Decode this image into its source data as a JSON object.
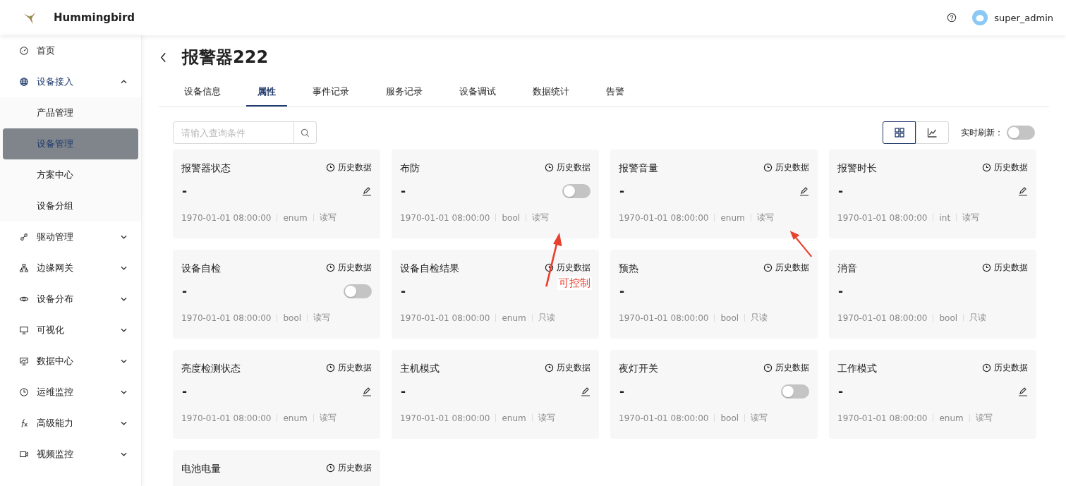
{
  "header": {
    "brand": "Hummingbird",
    "user": "super_admin"
  },
  "sidebar": {
    "items": [
      {
        "label": "首页",
        "expanded": false
      },
      {
        "label": "设备接入",
        "expanded": true,
        "children": [
          {
            "label": "产品管理",
            "selected": false
          },
          {
            "label": "设备管理",
            "selected": true
          },
          {
            "label": "方案中心",
            "selected": false
          },
          {
            "label": "设备分组",
            "selected": false
          }
        ]
      },
      {
        "label": "驱动管理",
        "expanded": false
      },
      {
        "label": "边缘网关",
        "expanded": false
      },
      {
        "label": "设备分布",
        "expanded": false
      },
      {
        "label": "可视化",
        "expanded": false
      },
      {
        "label": "数据中心",
        "expanded": false
      },
      {
        "label": "运维监控",
        "expanded": false
      },
      {
        "label": "高级能力",
        "expanded": false
      },
      {
        "label": "视频监控",
        "expanded": false
      }
    ]
  },
  "page": {
    "title": "报警器222"
  },
  "tabs": [
    {
      "label": "设备信息",
      "selected": false
    },
    {
      "label": "属性",
      "selected": true
    },
    {
      "label": "事件记录",
      "selected": false
    },
    {
      "label": "服务记录",
      "selected": false
    },
    {
      "label": "设备调试",
      "selected": false
    },
    {
      "label": "数据统计",
      "selected": false
    },
    {
      "label": "告警",
      "selected": false
    }
  ],
  "search": {
    "placeholder": "请输入查询条件"
  },
  "view_toggle": [
    {
      "kind": "grid",
      "selected": true
    },
    {
      "kind": "chart",
      "selected": false
    }
  ],
  "realtime": {
    "label": "实时刷新：",
    "on": false
  },
  "cards": [
    {
      "name": "报警器状态",
      "history": "历史数据",
      "value": "-",
      "kind": "edit",
      "time": "1970-01-01 08:00:00",
      "type": "enum",
      "access": "读写"
    },
    {
      "name": "布防",
      "history": "历史数据",
      "value": "-",
      "kind": "switch",
      "on": false,
      "time": "1970-01-01 08:00:00",
      "type": "bool",
      "access": "读写"
    },
    {
      "name": "报警音量",
      "history": "历史数据",
      "value": "-",
      "kind": "edit",
      "time": "1970-01-01 08:00:00",
      "type": "enum",
      "access": "读写"
    },
    {
      "name": "报警时长",
      "history": "历史数据",
      "value": "-",
      "kind": "edit",
      "time": "1970-01-01 08:00:00",
      "type": "int",
      "access": "读写"
    },
    {
      "name": "设备自检",
      "history": "历史数据",
      "value": "-",
      "kind": "switch",
      "on": false,
      "time": "1970-01-01 08:00:00",
      "type": "bool",
      "access": "读写"
    },
    {
      "name": "设备自检结果",
      "history": "历史数据",
      "value": "-",
      "kind": "none",
      "time": "1970-01-01 08:00:00",
      "type": "enum",
      "access": "只读"
    },
    {
      "name": "预热",
      "history": "历史数据",
      "value": "-",
      "kind": "none",
      "time": "1970-01-01 08:00:00",
      "type": "bool",
      "access": "只读"
    },
    {
      "name": "消音",
      "history": "历史数据",
      "value": "-",
      "kind": "none",
      "time": "1970-01-01 08:00:00",
      "type": "bool",
      "access": "只读"
    },
    {
      "name": "亮度检测状态",
      "history": "历史数据",
      "value": "-",
      "kind": "edit",
      "time": "1970-01-01 08:00:00",
      "type": "enum",
      "access": "读写"
    },
    {
      "name": "主机模式",
      "history": "历史数据",
      "value": "-",
      "kind": "edit",
      "time": "1970-01-01 08:00:00",
      "type": "enum",
      "access": "读写"
    },
    {
      "name": "夜灯开关",
      "history": "历史数据",
      "value": "-",
      "kind": "switch",
      "on": false,
      "time": "1970-01-01 08:00:00",
      "type": "bool",
      "access": "读写"
    },
    {
      "name": "工作模式",
      "history": "历史数据",
      "value": "-",
      "kind": "edit",
      "time": "1970-01-01 08:00:00",
      "type": "enum",
      "access": "读写"
    },
    {
      "name": "电池电量",
      "history": "历史数据"
    }
  ],
  "annotation": {
    "text": "可控制"
  }
}
